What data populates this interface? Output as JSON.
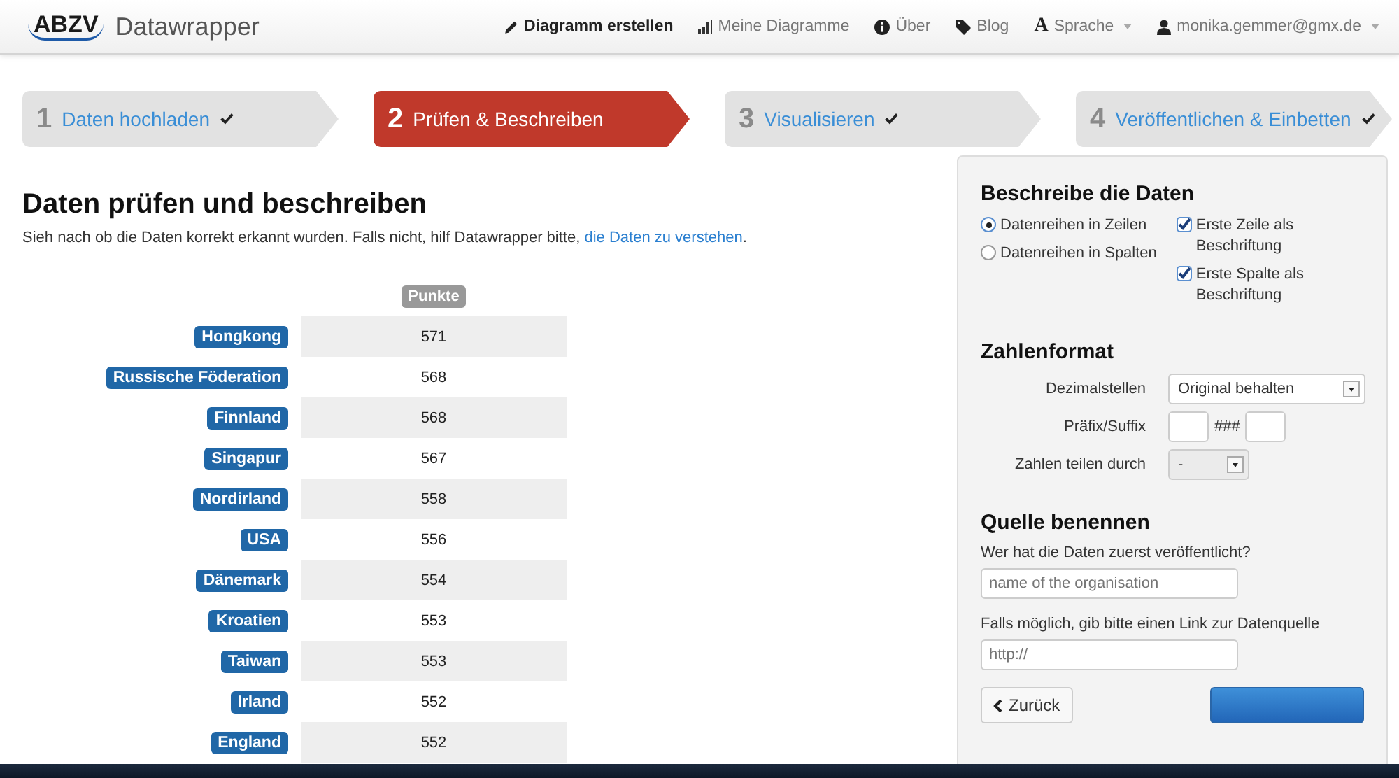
{
  "brand": {
    "logo": "ABZV",
    "name": "Datawrapper"
  },
  "nav": [
    {
      "label": "Diagramm erstellen",
      "selected": true,
      "dropdown": false
    },
    {
      "label": "Meine Diagramme",
      "selected": false,
      "dropdown": false
    },
    {
      "label": "Über",
      "selected": false,
      "dropdown": false
    },
    {
      "label": "Blog",
      "selected": false,
      "dropdown": false
    },
    {
      "label": "Sprache",
      "glyph": "A",
      "selected": false,
      "dropdown": true
    },
    {
      "label": "monika.gemmer@gmx.de",
      "selected": false,
      "dropdown": true
    }
  ],
  "steps": [
    {
      "number": "1",
      "label": "Daten hochladen",
      "done": true,
      "selected": false
    },
    {
      "number": "2",
      "label": "Prüfen & Beschreiben",
      "done": false,
      "selected": true
    },
    {
      "number": "3",
      "label": "Visualisieren",
      "done": true,
      "selected": false
    },
    {
      "number": "4",
      "label": "Veröffentlichen & Einbetten",
      "done": true,
      "selected": false
    }
  ],
  "main": {
    "title": "Daten prüfen und beschreiben",
    "intro": "Sieh nach ob die Daten korrekt erkannt wurden. Falls nicht, hilf Datawrapper bitte, ",
    "intro_link": "die Daten zu verstehen",
    "intro_end": "."
  },
  "table": {
    "columns": [
      "Punkte"
    ],
    "rows": [
      {
        "label": "Hongkong",
        "value": "571"
      },
      {
        "label": "Russische Föderation",
        "value": "568"
      },
      {
        "label": "Finnland",
        "value": "568"
      },
      {
        "label": "Singapur",
        "value": "567"
      },
      {
        "label": "Nordirland",
        "value": "558"
      },
      {
        "label": "USA",
        "value": "556"
      },
      {
        "label": "Dänemark",
        "value": "554"
      },
      {
        "label": "Kroatien",
        "value": "553"
      },
      {
        "label": "Taiwan",
        "value": "553"
      },
      {
        "label": "Irland",
        "value": "552"
      },
      {
        "label": "England",
        "value": "552"
      }
    ]
  },
  "panel": {
    "describe": {
      "title": "Beschreibe die Daten",
      "radios": [
        {
          "label": "Datenreihen in Zeilen",
          "selected": true
        },
        {
          "label": "Datenreihen in Spalten",
          "selected": false
        }
      ],
      "checkboxes": [
        {
          "label": "Erste Zeile als Beschriftung",
          "checked": true
        },
        {
          "label": "Erste Spalte als Beschriftung",
          "checked": true
        }
      ]
    },
    "number_format": {
      "title": "Zahlenformat",
      "fields": [
        {
          "kind": "select",
          "label": "Dezimalstellen",
          "value": "Original behalten"
        },
        {
          "kind": "affix",
          "label": "Präfix/Suffix",
          "separator": "###"
        },
        {
          "kind": "select-small",
          "label": "Zahlen teilen durch",
          "value": "-"
        }
      ]
    },
    "source": {
      "title": "Quelle benennen",
      "fields": [
        {
          "label": "Wer hat die Daten zuerst veröffentlicht?",
          "placeholder": "name of the organisation"
        },
        {
          "label": "Falls möglich, gib bitte einen Link zur Datenquelle",
          "placeholder": "http://"
        }
      ]
    },
    "buttons": [
      {
        "kind": "back",
        "label": "Zurück"
      },
      {
        "kind": "next"
      }
    ]
  }
}
